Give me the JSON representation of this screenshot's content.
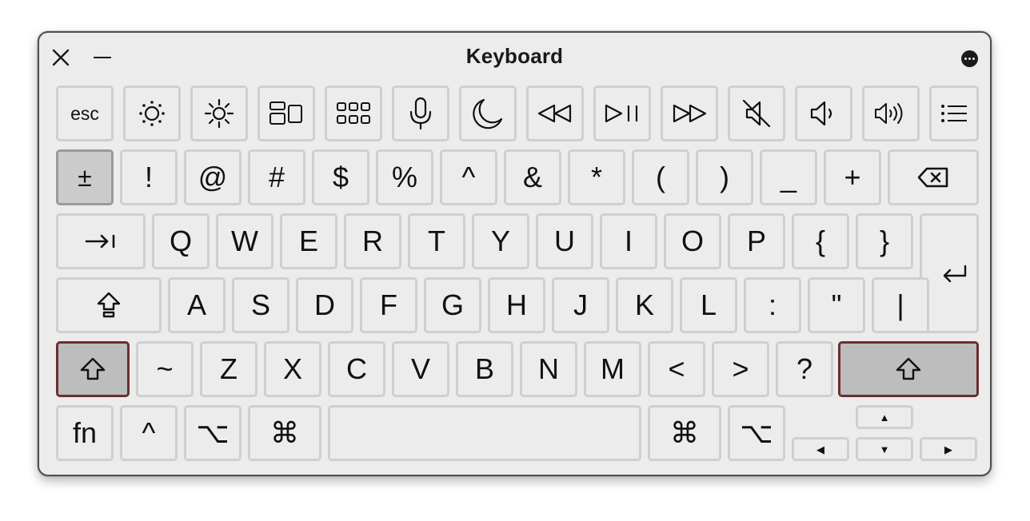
{
  "window": {
    "title": "Keyboard"
  },
  "icons": {
    "close": "close-icon",
    "minimize": "minimize-icon",
    "more": "ellipsis-circle-icon"
  },
  "rows": {
    "function": [
      {
        "label": "esc",
        "name": "key-esc"
      },
      {
        "icon": "brightness-down-icon",
        "name": "key-brightness-down"
      },
      {
        "icon": "brightness-up-icon",
        "name": "key-brightness-up"
      },
      {
        "icon": "mission-control-icon",
        "name": "key-mission-control"
      },
      {
        "icon": "launchpad-icon",
        "name": "key-launchpad"
      },
      {
        "icon": "microphone-icon",
        "name": "key-dictation"
      },
      {
        "icon": "moon-icon",
        "name": "key-focus"
      },
      {
        "icon": "rewind-icon",
        "name": "key-previous-track"
      },
      {
        "icon": "play-pause-icon",
        "name": "key-play-pause"
      },
      {
        "icon": "fast-forward-icon",
        "name": "key-next-track"
      },
      {
        "icon": "mute-icon",
        "name": "key-mute"
      },
      {
        "icon": "volume-down-icon",
        "name": "key-volume-down"
      },
      {
        "icon": "volume-up-icon",
        "name": "key-volume-up"
      },
      {
        "icon": "list-icon",
        "name": "key-list"
      }
    ],
    "number": [
      "±",
      "!",
      "@",
      "#",
      "$",
      "%",
      "^",
      "&",
      "*",
      "(",
      ")",
      "_",
      "+"
    ],
    "qwerty": [
      "Q",
      "W",
      "E",
      "R",
      "T",
      "Y",
      "U",
      "I",
      "O",
      "P",
      "{",
      "}"
    ],
    "home": [
      "A",
      "S",
      "D",
      "F",
      "G",
      "H",
      "J",
      "K",
      "L",
      ":",
      "\"",
      "|"
    ],
    "shift_row": [
      "~",
      "Z",
      "X",
      "C",
      "V",
      "B",
      "N",
      "M",
      "<",
      ">",
      "?"
    ],
    "bottom": {
      "fn": "fn",
      "control": "^",
      "option": "⌥",
      "command": "⌘",
      "right_command": "⌘",
      "right_option": "⌥"
    },
    "arrows": {
      "up": "▲",
      "left": "◀",
      "down": "▼",
      "right": "▶"
    }
  },
  "state": {
    "pressed_key": "±",
    "shift_active": true
  },
  "colors": {
    "window_bg": "#ececec",
    "key_bg": "#ececec",
    "key_border": "#cfcfcf",
    "active_shift_border": "#6b2f2f",
    "active_shift_bg": "#bdbdbd"
  }
}
